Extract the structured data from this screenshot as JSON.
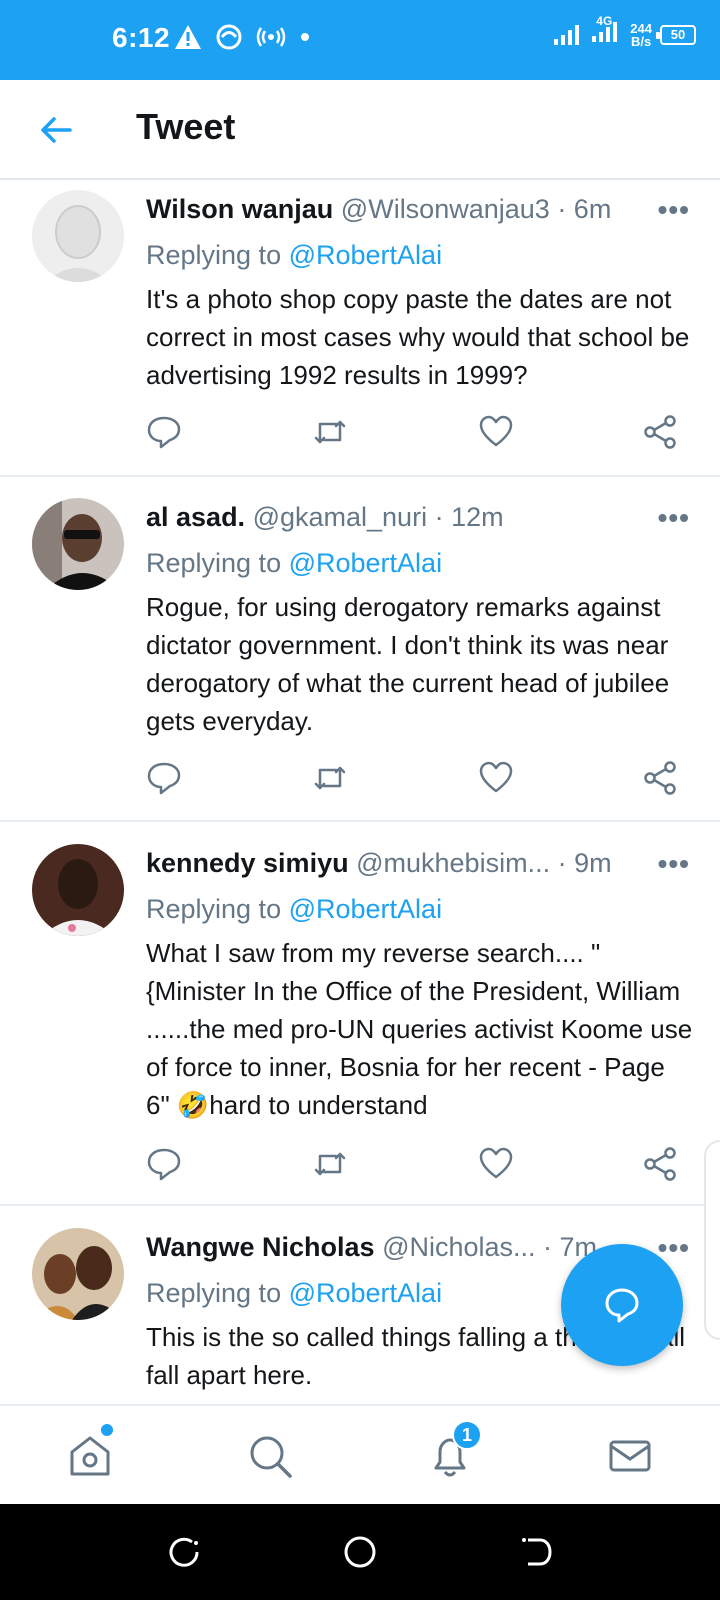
{
  "status_bar": {
    "time": "6:12",
    "network": "4G",
    "speed_value": "244",
    "speed_unit": "B/s",
    "battery": "50"
  },
  "header": {
    "title": "Tweet"
  },
  "tweets": [
    {
      "name": "Wilson wanjau",
      "handle": "@Wilsonwanjau3",
      "time": "· 6m",
      "replying_prefix": "Replying to ",
      "replying_to": "@RobertAlai",
      "text": "It's a photo shop copy paste the dates are not correct in most cases why would that school be advertising 1992 results in 1999?"
    },
    {
      "name": "al asad.",
      "handle": "@gkamal_nuri",
      "time": "· 12m",
      "replying_prefix": "Replying to ",
      "replying_to": "@RobertAlai",
      "text": "Rogue, for using derogatory remarks against dictator government. I don't think its was near derogatory of  what the current head of jubilee gets everyday."
    },
    {
      "name": "kennedy simiyu",
      "handle": "@mukhebisim...",
      "time": "· 9m",
      "replying_prefix": "Replying to ",
      "replying_to": "@RobertAlai",
      "text": "What I saw from my reverse search.... \" {Minister In the Office of the President, William ......the med pro-UN queries activist Koome use of force to inner, Bosnia for her recent - Page 6\" 🤣hard to understand"
    },
    {
      "name": "Wangwe Nicholas",
      "handle": "@Nicholas...",
      "time": "· 7m",
      "replying_prefix": "Replying to ",
      "replying_to": "@RobertAlai",
      "text": "This is the so called things falling a things shall fall apart here."
    }
  ],
  "more_label": "•••",
  "bottom_nav": {
    "notifications_badge": "1"
  },
  "icons": {
    "back": "arrow-left-icon",
    "reply": "reply-icon",
    "retweet": "retweet-icon",
    "like": "heart-icon",
    "share": "share-icon",
    "compose": "compose-reply-icon",
    "home": "home-icon",
    "search": "search-icon",
    "notifications": "bell-icon",
    "messages": "mail-icon"
  },
  "colors": {
    "accent": "#1da1f2",
    "text": "#14171a",
    "muted": "#657786"
  }
}
